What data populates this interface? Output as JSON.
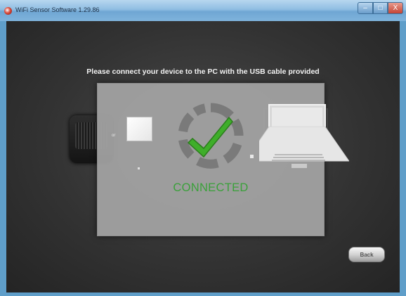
{
  "window": {
    "title": "WiFi Sensor Software 1.29.86",
    "controls": {
      "minimize": "–",
      "maximize": "□",
      "close": "X"
    }
  },
  "instruction": "Please connect your device to the PC with the USB cable provided",
  "overlay": {
    "or_label": "or",
    "status": "CONNECTED",
    "status_color": "#3aa13a"
  },
  "back_button": {
    "label": "Back"
  }
}
